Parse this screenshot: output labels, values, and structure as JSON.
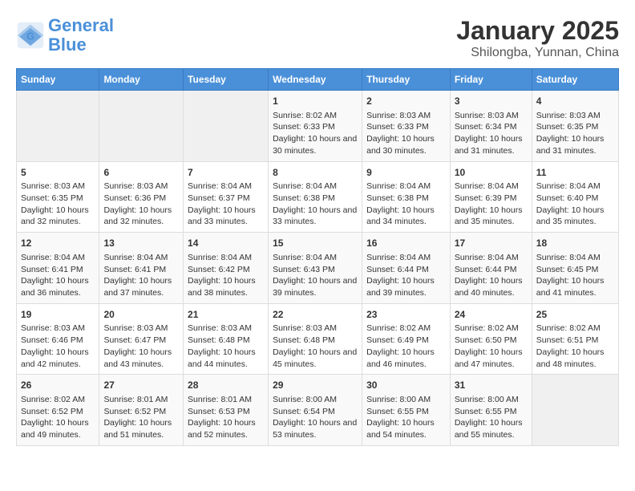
{
  "header": {
    "logo_line1": "General",
    "logo_line2": "Blue",
    "title": "January 2025",
    "subtitle": "Shilongba, Yunnan, China"
  },
  "calendar": {
    "days_of_week": [
      "Sunday",
      "Monday",
      "Tuesday",
      "Wednesday",
      "Thursday",
      "Friday",
      "Saturday"
    ],
    "weeks": [
      [
        {
          "day": "",
          "empty": true
        },
        {
          "day": "",
          "empty": true
        },
        {
          "day": "",
          "empty": true
        },
        {
          "day": "1",
          "sunrise": "8:02 AM",
          "sunset": "6:33 PM",
          "daylight": "10 hours and 30 minutes."
        },
        {
          "day": "2",
          "sunrise": "8:03 AM",
          "sunset": "6:33 PM",
          "daylight": "10 hours and 30 minutes."
        },
        {
          "day": "3",
          "sunrise": "8:03 AM",
          "sunset": "6:34 PM",
          "daylight": "10 hours and 31 minutes."
        },
        {
          "day": "4",
          "sunrise": "8:03 AM",
          "sunset": "6:35 PM",
          "daylight": "10 hours and 31 minutes."
        }
      ],
      [
        {
          "day": "5",
          "sunrise": "8:03 AM",
          "sunset": "6:35 PM",
          "daylight": "10 hours and 32 minutes."
        },
        {
          "day": "6",
          "sunrise": "8:03 AM",
          "sunset": "6:36 PM",
          "daylight": "10 hours and 32 minutes."
        },
        {
          "day": "7",
          "sunrise": "8:04 AM",
          "sunset": "6:37 PM",
          "daylight": "10 hours and 33 minutes."
        },
        {
          "day": "8",
          "sunrise": "8:04 AM",
          "sunset": "6:38 PM",
          "daylight": "10 hours and 33 minutes."
        },
        {
          "day": "9",
          "sunrise": "8:04 AM",
          "sunset": "6:38 PM",
          "daylight": "10 hours and 34 minutes."
        },
        {
          "day": "10",
          "sunrise": "8:04 AM",
          "sunset": "6:39 PM",
          "daylight": "10 hours and 35 minutes."
        },
        {
          "day": "11",
          "sunrise": "8:04 AM",
          "sunset": "6:40 PM",
          "daylight": "10 hours and 35 minutes."
        }
      ],
      [
        {
          "day": "12",
          "sunrise": "8:04 AM",
          "sunset": "6:41 PM",
          "daylight": "10 hours and 36 minutes."
        },
        {
          "day": "13",
          "sunrise": "8:04 AM",
          "sunset": "6:41 PM",
          "daylight": "10 hours and 37 minutes."
        },
        {
          "day": "14",
          "sunrise": "8:04 AM",
          "sunset": "6:42 PM",
          "daylight": "10 hours and 38 minutes."
        },
        {
          "day": "15",
          "sunrise": "8:04 AM",
          "sunset": "6:43 PM",
          "daylight": "10 hours and 39 minutes."
        },
        {
          "day": "16",
          "sunrise": "8:04 AM",
          "sunset": "6:44 PM",
          "daylight": "10 hours and 39 minutes."
        },
        {
          "day": "17",
          "sunrise": "8:04 AM",
          "sunset": "6:44 PM",
          "daylight": "10 hours and 40 minutes."
        },
        {
          "day": "18",
          "sunrise": "8:04 AM",
          "sunset": "6:45 PM",
          "daylight": "10 hours and 41 minutes."
        }
      ],
      [
        {
          "day": "19",
          "sunrise": "8:03 AM",
          "sunset": "6:46 PM",
          "daylight": "10 hours and 42 minutes."
        },
        {
          "day": "20",
          "sunrise": "8:03 AM",
          "sunset": "6:47 PM",
          "daylight": "10 hours and 43 minutes."
        },
        {
          "day": "21",
          "sunrise": "8:03 AM",
          "sunset": "6:48 PM",
          "daylight": "10 hours and 44 minutes."
        },
        {
          "day": "22",
          "sunrise": "8:03 AM",
          "sunset": "6:48 PM",
          "daylight": "10 hours and 45 minutes."
        },
        {
          "day": "23",
          "sunrise": "8:02 AM",
          "sunset": "6:49 PM",
          "daylight": "10 hours and 46 minutes."
        },
        {
          "day": "24",
          "sunrise": "8:02 AM",
          "sunset": "6:50 PM",
          "daylight": "10 hours and 47 minutes."
        },
        {
          "day": "25",
          "sunrise": "8:02 AM",
          "sunset": "6:51 PM",
          "daylight": "10 hours and 48 minutes."
        }
      ],
      [
        {
          "day": "26",
          "sunrise": "8:02 AM",
          "sunset": "6:52 PM",
          "daylight": "10 hours and 49 minutes."
        },
        {
          "day": "27",
          "sunrise": "8:01 AM",
          "sunset": "6:52 PM",
          "daylight": "10 hours and 51 minutes."
        },
        {
          "day": "28",
          "sunrise": "8:01 AM",
          "sunset": "6:53 PM",
          "daylight": "10 hours and 52 minutes."
        },
        {
          "day": "29",
          "sunrise": "8:00 AM",
          "sunset": "6:54 PM",
          "daylight": "10 hours and 53 minutes."
        },
        {
          "day": "30",
          "sunrise": "8:00 AM",
          "sunset": "6:55 PM",
          "daylight": "10 hours and 54 minutes."
        },
        {
          "day": "31",
          "sunrise": "8:00 AM",
          "sunset": "6:55 PM",
          "daylight": "10 hours and 55 minutes."
        },
        {
          "day": "",
          "empty": true
        }
      ]
    ]
  }
}
